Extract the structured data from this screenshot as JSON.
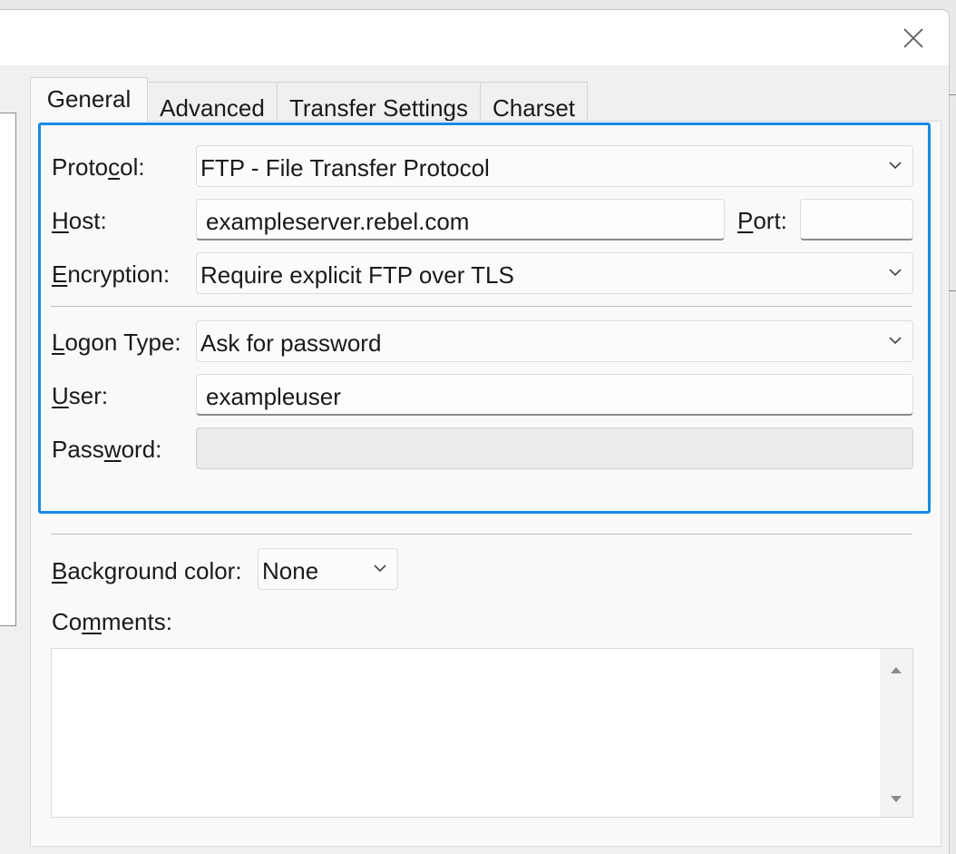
{
  "window": {
    "close_icon": "close-icon"
  },
  "tabs": [
    {
      "label": "General",
      "active": true
    },
    {
      "label": "Advanced",
      "active": false
    },
    {
      "label": "Transfer Settings",
      "active": false
    },
    {
      "label": "Charset",
      "active": false
    }
  ],
  "general": {
    "protocol": {
      "label_pre": "Proto",
      "label_u": "c",
      "label_post": "ol:",
      "value": "FTP - File Transfer Protocol"
    },
    "host": {
      "label_pre": "",
      "label_u": "H",
      "label_post": "ost:",
      "value": "exampleserver.rebel.com"
    },
    "port": {
      "label_pre": "",
      "label_u": "P",
      "label_post": "ort:",
      "value": ""
    },
    "encryption": {
      "label_pre": "",
      "label_u": "E",
      "label_post": "ncryption:",
      "value": "Require explicit FTP over TLS"
    },
    "logon_type": {
      "label_pre": "",
      "label_u": "L",
      "label_post": "ogon Type:",
      "value": "Ask for password"
    },
    "user": {
      "label_pre": "",
      "label_u": "U",
      "label_post": "ser:",
      "value": "exampleuser"
    },
    "password": {
      "label_pre": "Pass",
      "label_u": "w",
      "label_post": "ord:",
      "value": ""
    },
    "background_color": {
      "label_pre": "",
      "label_u": "B",
      "label_post": "ackground color:",
      "value": "None"
    },
    "comments": {
      "label_pre": "Co",
      "label_u": "m",
      "label_post": "ments:",
      "value": ""
    }
  },
  "colors": {
    "focus_border": "#1a8ae5"
  }
}
